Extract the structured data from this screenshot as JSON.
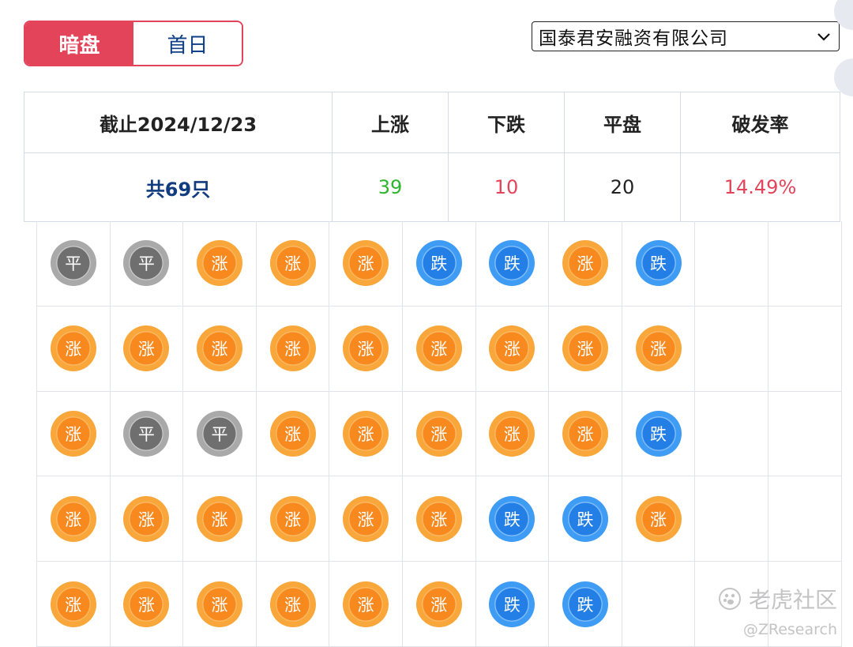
{
  "tabs": [
    {
      "label": "暗盘",
      "active": true
    },
    {
      "label": "首日",
      "active": false
    }
  ],
  "broker_select": {
    "selected": "国泰君安融资有限公司"
  },
  "summary": {
    "headers": [
      "截止2024/12/23",
      "上涨",
      "下跌",
      "平盘",
      "破发率"
    ],
    "total": "共69只",
    "up": "39",
    "down": "10",
    "flat": "20",
    "break_rate": "14.49%"
  },
  "labels": {
    "up": "涨",
    "down": "跌",
    "flat": "平"
  },
  "colors": {
    "accent": "#e3445a",
    "up_text": "#2db52d",
    "down_text": "#e3445a",
    "total_text": "#123c7f",
    "coin_up": "#f7891f",
    "coin_down": "#237fe6",
    "coin_flat": "#6f6f6f"
  },
  "grid": [
    [
      "flat",
      "flat",
      "up",
      "up",
      "up",
      "down",
      "down",
      "up",
      "down",
      "",
      ""
    ],
    [
      "up",
      "up",
      "up",
      "up",
      "up",
      "up",
      "up",
      "up",
      "up",
      "",
      ""
    ],
    [
      "up",
      "flat",
      "flat",
      "up",
      "up",
      "up",
      "up",
      "up",
      "down",
      "",
      ""
    ],
    [
      "up",
      "up",
      "up",
      "up",
      "up",
      "up",
      "down",
      "down",
      "up",
      "",
      ""
    ],
    [
      "up",
      "up",
      "up",
      "up",
      "up",
      "up",
      "down",
      "down",
      "",
      "",
      ""
    ]
  ],
  "watermark": {
    "brand": "老虎社区",
    "handle": "@ZResearch",
    "icon": "tiger-paw-icon"
  }
}
